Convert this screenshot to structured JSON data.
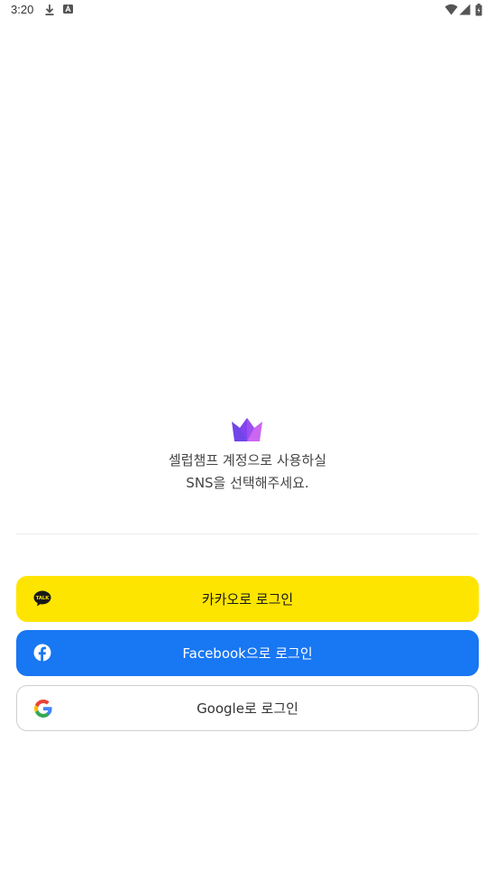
{
  "status_bar": {
    "time": "3:20",
    "icons": [
      "download-icon",
      "font-icon",
      "wifi-icon",
      "signal-icon",
      "battery-icon"
    ]
  },
  "brand": {
    "logo_icon": "crown-icon",
    "colors": {
      "left": "#6A3BE8",
      "right": "#C24BEF"
    }
  },
  "intro": {
    "line1": "셀럽챔프 계정으로 사용하실",
    "line2": "SNS을 선택해주세요."
  },
  "login": {
    "kakao": {
      "label": "카카오로 로그인",
      "icon": "kakao-talk-icon",
      "color": "#FEE500"
    },
    "facebook": {
      "label": "Facebook으로 로그인",
      "icon": "facebook-icon",
      "color": "#1877F2"
    },
    "google": {
      "label": "Google로 로그인",
      "icon": "google-icon",
      "color": "#FFFFFF"
    }
  }
}
